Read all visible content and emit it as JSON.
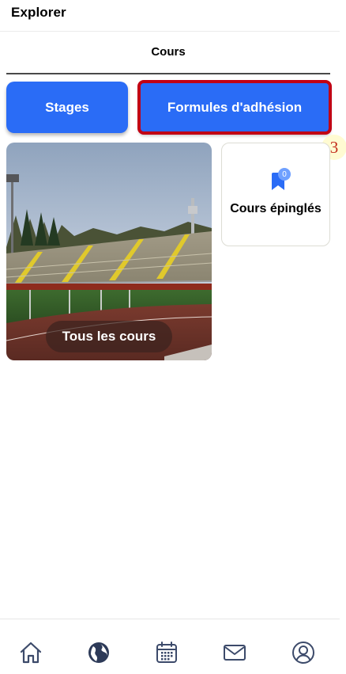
{
  "header": {
    "title": "Explorer"
  },
  "tabs": {
    "active_label": "Cours"
  },
  "buttons": {
    "stages_label": "Stages",
    "formules_label": "Formules d'adhésion"
  },
  "annotation": {
    "step_number": "3",
    "highlight_color": "#c10014"
  },
  "cards": {
    "all_courses_label": "Tous les cours",
    "pinned_label": "Cours épinglés",
    "pinned_count": "0"
  },
  "bottom_nav": {
    "items": [
      {
        "icon": "home-icon"
      },
      {
        "icon": "globe-icon"
      },
      {
        "icon": "calendar-icon"
      },
      {
        "icon": "mail-icon"
      },
      {
        "icon": "user-icon"
      }
    ]
  },
  "colors": {
    "accent": "#2a6cf6",
    "nav_icon": "#3c4a6a"
  }
}
